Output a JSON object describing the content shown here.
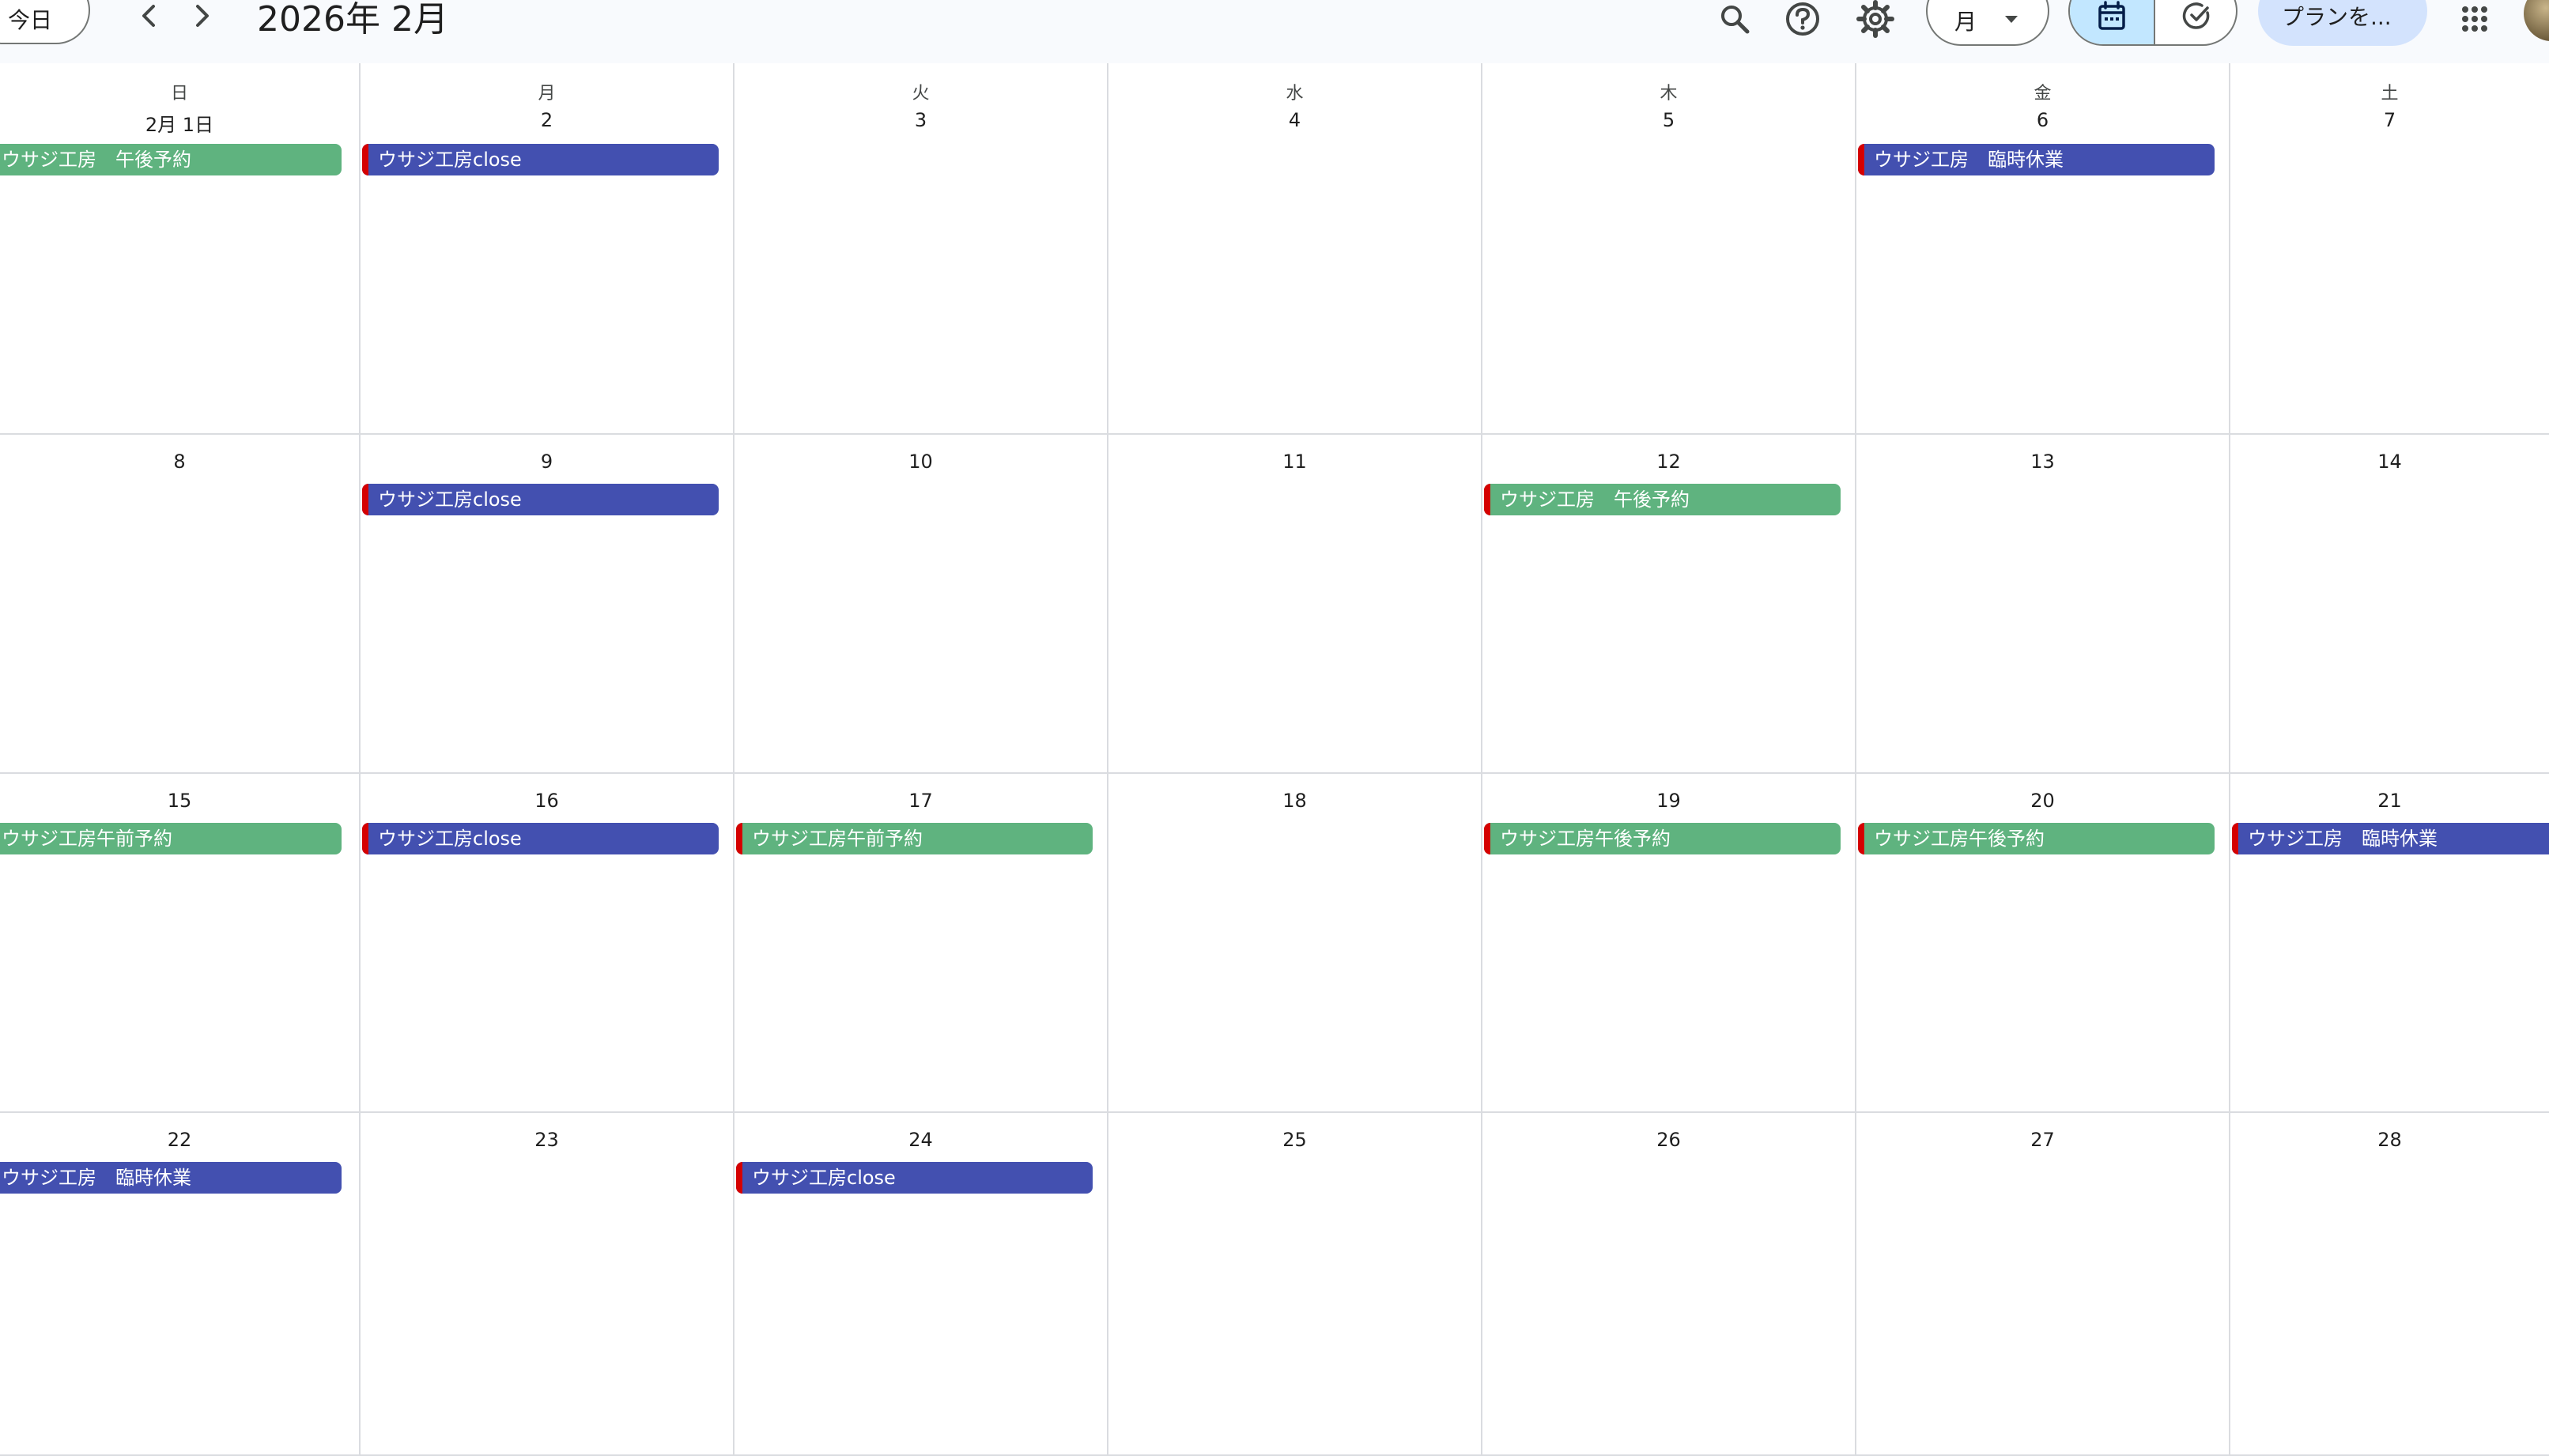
{
  "header": {
    "today_label": "今日",
    "title": "2026年 2月",
    "view_label": "月",
    "plan_label": "プランを..."
  },
  "colors": {
    "event_green": "#5fb37f",
    "event_blue": "#4350b0",
    "marker_red": "#d50000",
    "selected_segment": "#c2e7ff",
    "plan_button": "#d3e3fd"
  },
  "weekdays": [
    "日",
    "月",
    "火",
    "水",
    "木",
    "金",
    "土"
  ],
  "weeks": [
    {
      "days": [
        {
          "label": "2月 1日",
          "events": [
            {
              "title": "ウサジ工房　午後予約",
              "color": "green",
              "marked": false
            }
          ]
        },
        {
          "label": "2",
          "events": [
            {
              "title": "ウサジ工房close",
              "color": "blue",
              "marked": true
            }
          ]
        },
        {
          "label": "3",
          "events": []
        },
        {
          "label": "4",
          "events": []
        },
        {
          "label": "5",
          "events": []
        },
        {
          "label": "6",
          "events": [
            {
              "title": "ウサジ工房　臨時休業",
              "color": "blue",
              "marked": true
            }
          ]
        },
        {
          "label": "7",
          "events": []
        }
      ]
    },
    {
      "days": [
        {
          "label": "8",
          "events": []
        },
        {
          "label": "9",
          "events": [
            {
              "title": "ウサジ工房close",
              "color": "blue",
              "marked": true
            }
          ]
        },
        {
          "label": "10",
          "events": []
        },
        {
          "label": "11",
          "events": []
        },
        {
          "label": "12",
          "events": [
            {
              "title": "ウサジ工房　午後予約",
              "color": "green",
              "marked": true
            }
          ]
        },
        {
          "label": "13",
          "events": []
        },
        {
          "label": "14",
          "events": []
        }
      ]
    },
    {
      "days": [
        {
          "label": "15",
          "events": [
            {
              "title": "ウサジ工房午前予約",
              "color": "green",
              "marked": false
            }
          ]
        },
        {
          "label": "16",
          "events": [
            {
              "title": "ウサジ工房close",
              "color": "blue",
              "marked": true
            }
          ]
        },
        {
          "label": "17",
          "events": [
            {
              "title": "ウサジ工房午前予約",
              "color": "green",
              "marked": true
            }
          ]
        },
        {
          "label": "18",
          "events": []
        },
        {
          "label": "19",
          "events": [
            {
              "title": "ウサジ工房午後予約",
              "color": "green",
              "marked": true
            }
          ]
        },
        {
          "label": "20",
          "events": [
            {
              "title": "ウサジ工房午後予約",
              "color": "green",
              "marked": true
            }
          ]
        },
        {
          "label": "21",
          "events": [
            {
              "title": "ウサジ工房　臨時休業",
              "color": "blue",
              "marked": true
            }
          ]
        }
      ]
    },
    {
      "days": [
        {
          "label": "22",
          "events": [
            {
              "title": "ウサジ工房　臨時休業",
              "color": "blue",
              "marked": false
            }
          ]
        },
        {
          "label": "23",
          "events": []
        },
        {
          "label": "24",
          "events": [
            {
              "title": "ウサジ工房close",
              "color": "blue",
              "marked": true
            }
          ]
        },
        {
          "label": "25",
          "events": []
        },
        {
          "label": "26",
          "events": []
        },
        {
          "label": "27",
          "events": []
        },
        {
          "label": "28",
          "events": []
        }
      ]
    }
  ]
}
